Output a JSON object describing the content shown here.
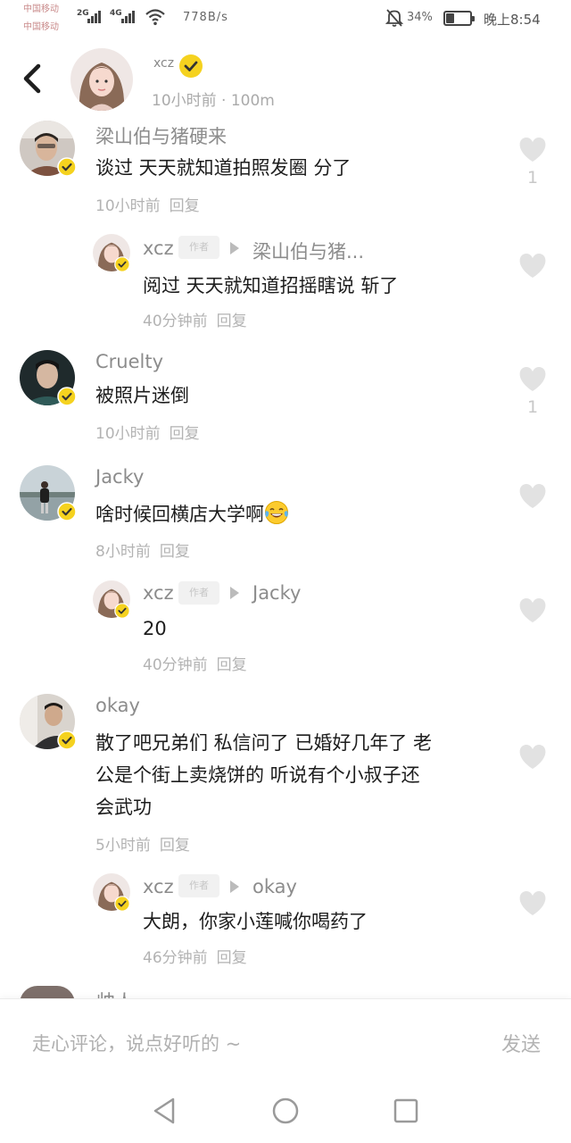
{
  "status_bar": {
    "carrier_1": "中国移动",
    "carrier_2": "中国移动",
    "net_1": "2G",
    "net_2": "4G",
    "speed": "778B/s",
    "battery_percent": "34%",
    "battery_level": 0.34,
    "time": "晚上8:54"
  },
  "header": {
    "author_name": "xcz",
    "meta": "10小时前 · 100m",
    "back_icon": "chevron-left-icon",
    "verified_icon": "verified-check-icon"
  },
  "comments": [
    {
      "name": "梁山伯与猪硬来",
      "text": "谈过 天天就知道拍照发圈 分了",
      "time": "10小时前",
      "reply_label": "回复",
      "likes": "1"
    },
    {
      "name": "xcz",
      "author_tag": "作者",
      "reply_to": "梁山伯与猪...",
      "text": "阅过 天天就知道招摇瞎说 斩了",
      "time": "40分钟前",
      "reply_label": "回复"
    },
    {
      "name": "Cruelty",
      "text": "被照片迷倒",
      "time": "10小时前",
      "reply_label": "回复",
      "likes": "1"
    },
    {
      "name": "Jacky",
      "text": "啥时候回横店大学啊",
      "emoji": "tears-of-joy-emoji",
      "time": "8小时前",
      "reply_label": "回复"
    },
    {
      "name": "xcz",
      "author_tag": "作者",
      "reply_to": "Jacky",
      "text": "20",
      "time": "40分钟前",
      "reply_label": "回复"
    },
    {
      "name": "okay",
      "text_lines": [
        "散了吧兄弟们 私信问了 已婚好几年了 老",
        "公是个街上卖烧饼的 听说有个小叔子还",
        "会武功"
      ],
      "time": "5小时前",
      "reply_label": "回复"
    },
    {
      "name": "xcz",
      "author_tag": "作者",
      "reply_to": "okay",
      "text": "大朗，你家小莲喊你喝药了",
      "time": "46分钟前",
      "reply_label": "回复"
    }
  ],
  "next_comment_partial_name": "帅人",
  "input_bar": {
    "placeholder": "走心评论，说点好听的 ~",
    "send_label": "发送"
  },
  "colors": {
    "verified_badge": "#f5d21f",
    "name_gray": "#8c8c8c",
    "time_gray": "#b3b3b3",
    "heart_gray": "#e2e2e2"
  }
}
